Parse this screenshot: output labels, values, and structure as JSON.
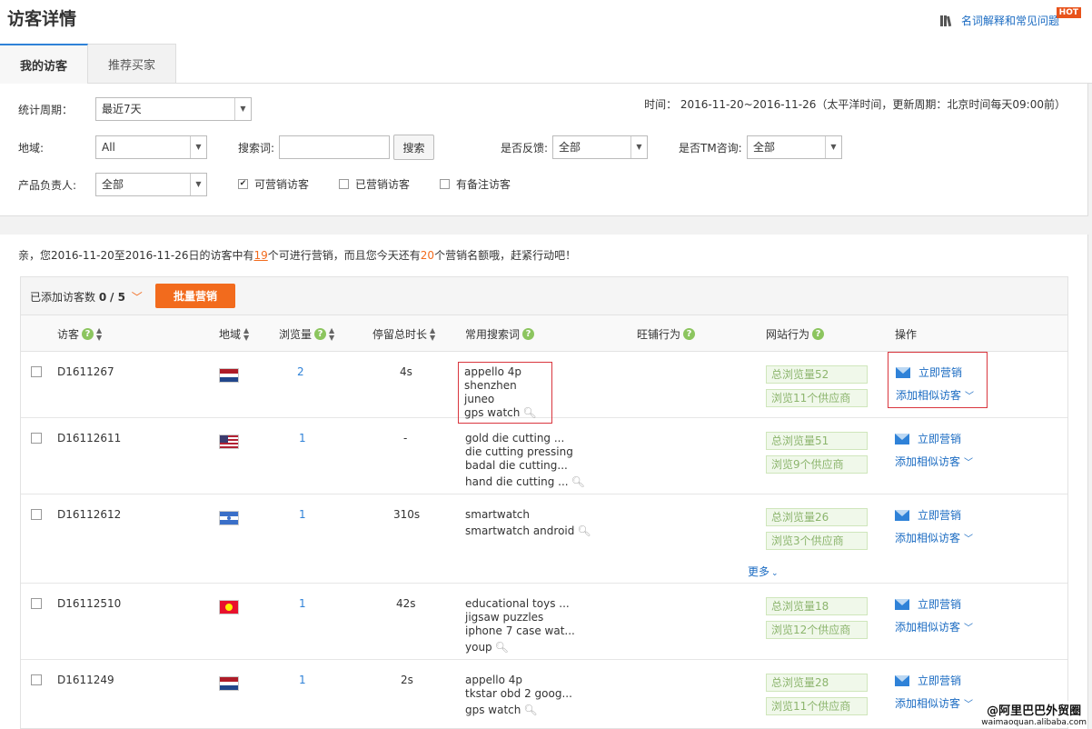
{
  "header": {
    "title": "访客详情",
    "help_link": "名词解释和常见问题",
    "hot_badge": "HOT"
  },
  "tabs": [
    {
      "label": "我的访客",
      "active": true
    },
    {
      "label": "推荐买家",
      "active": false
    }
  ],
  "filters": {
    "period_label": "统计周期：",
    "period_value": "最近7天",
    "time_info": "时间： 2016-11-20~2016-11-26（太平洋时间，更新周期：北京时间每天09:00前）",
    "region_label": "地域:",
    "region_value": "All",
    "search_label": "搜索词:",
    "search_value": "",
    "search_button": "搜索",
    "feedback_label": "是否反馈:",
    "feedback_value": "全部",
    "tm_label": "是否TM咨询:",
    "tm_value": "全部",
    "owner_label": "产品负责人:",
    "owner_value": "全部",
    "chk_marketable": "可营销访客",
    "chk_marketed": "已营销访客",
    "chk_noted": "有备注访客"
  },
  "notice": {
    "part1": "亲，您2016-11-20至2016-11-26日的访客中有",
    "count": "19",
    "part2": "个可进行营销，而且您今天还有",
    "quota": "20",
    "part3": "个营销名额哦，赶紧行动吧！"
  },
  "toolbar": {
    "added_label": "已添加访客数",
    "added_count": "0",
    "added_total": "/ 5",
    "batch_button": "批量营销"
  },
  "columns": {
    "visitor": "访客",
    "region": "地域",
    "views": "浏览量",
    "duration": "停留总时长",
    "keywords": "常用搜索词",
    "shop_behavior": "旺铺行为",
    "site_behavior": "网站行为",
    "actions": "操作"
  },
  "actions": {
    "market_now": "立即营销",
    "add_similar": "添加相似访客"
  },
  "more_label": "更多",
  "rows": [
    {
      "id": "D1611267",
      "flag": "nl",
      "views": "2",
      "duration": "4s",
      "keywords": [
        "appello 4p",
        "shenzhen juneo",
        "gps watch"
      ],
      "total_views": "总浏览量52",
      "suppliers": "浏览11个供应商"
    },
    {
      "id": "D16112611",
      "flag": "us",
      "views": "1",
      "duration": "-",
      "keywords": [
        "gold die cutting ...",
        "die cutting pressing",
        "badal die cutting...",
        "hand die cutting ..."
      ],
      "total_views": "总浏览量51",
      "suppliers": "浏览9个供应商"
    },
    {
      "id": "D16112612",
      "flag": "ni",
      "views": "1",
      "duration": "310s",
      "keywords": [
        "smartwatch",
        "smartwatch android"
      ],
      "total_views": "总浏览量26",
      "suppliers": "浏览3个供应商"
    },
    {
      "id": "D16112510",
      "flag": "kg",
      "views": "1",
      "duration": "42s",
      "keywords": [
        "educational toys ...",
        "jigsaw puzzles",
        "iphone 7 case wat...",
        "youp"
      ],
      "total_views": "总浏览量18",
      "suppliers": "浏览12个供应商"
    },
    {
      "id": "D1611249",
      "flag": "nl",
      "views": "1",
      "duration": "2s",
      "keywords": [
        "appello 4p",
        "tkstar obd 2 goog...",
        "gps watch"
      ],
      "total_views": "总浏览量28",
      "suppliers": "浏览11个供应商"
    }
  ],
  "watermark": {
    "line1": "@阿里巴巴外贸圈",
    "line2": "waimaoquan.alibaba.com"
  }
}
